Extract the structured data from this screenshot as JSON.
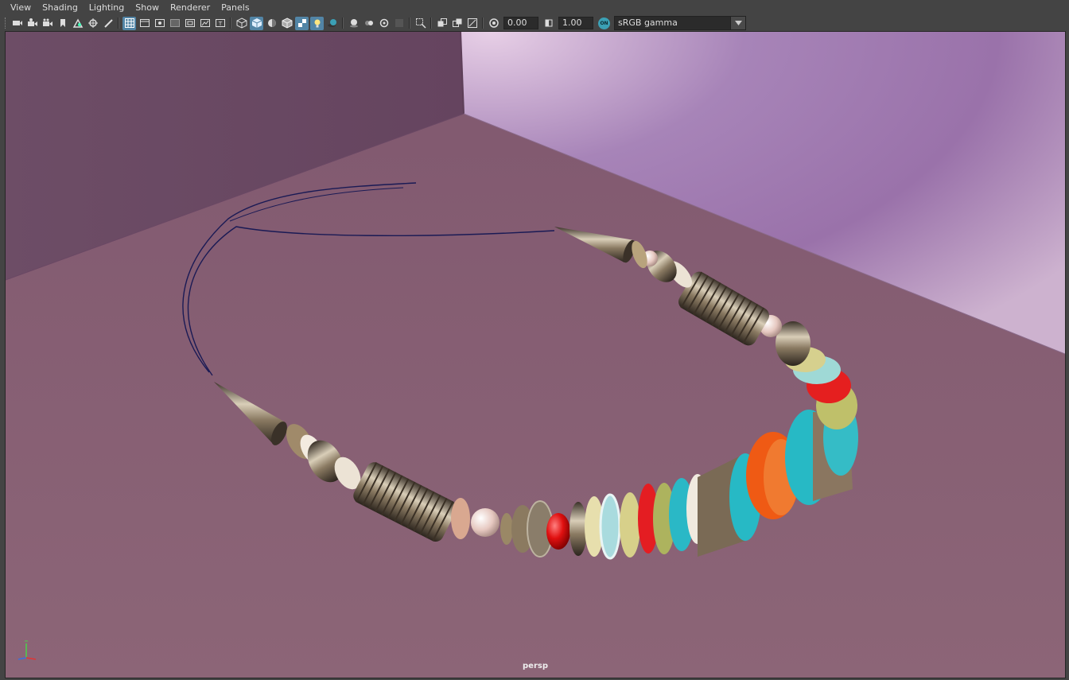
{
  "menu": [
    "View",
    "Shading",
    "Lighting",
    "Show",
    "Renderer",
    "Panels"
  ],
  "toolbar": {
    "exposure": "0.00",
    "gamma": "1.00",
    "color_management_label": "ON",
    "view_transform": "sRGB gamma"
  },
  "viewport": {
    "camera": "persp"
  },
  "colors": {
    "chrome": "#444444",
    "active_button": "#5285a6",
    "color_mgmt": "#3ba0b5"
  }
}
